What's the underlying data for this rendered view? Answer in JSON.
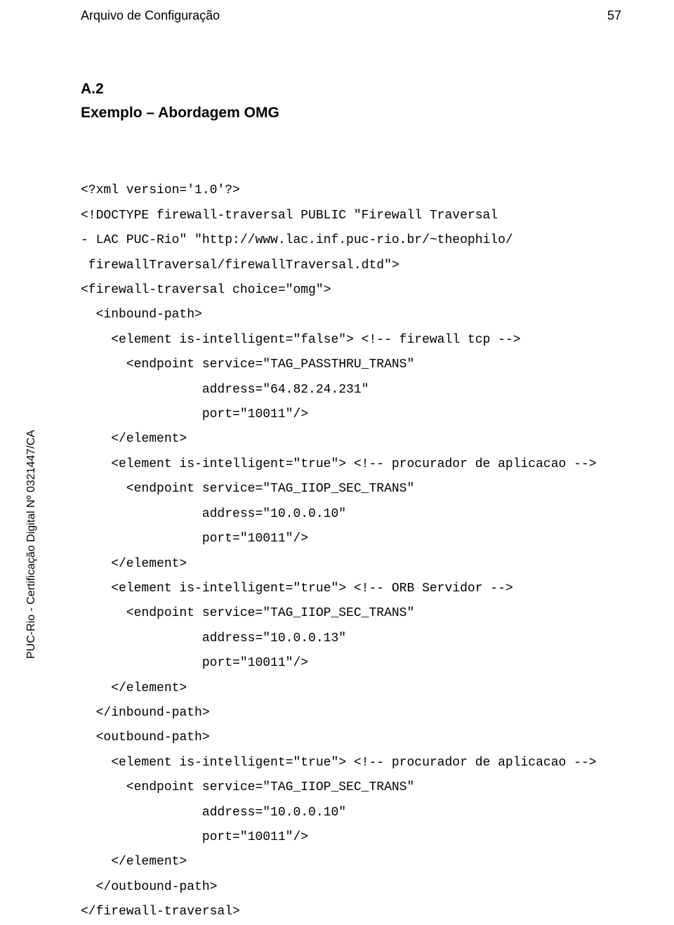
{
  "header": {
    "title": "Arquivo de Configuração",
    "page_number": "57"
  },
  "section": {
    "label": "A.2",
    "title": "Exemplo – Abordagem OMG"
  },
  "vertical_note": "PUC-Rio - Certificação Digital Nº 0321447/CA",
  "code": {
    "l01": "<?xml version='1.0'?>",
    "l02": "<!DOCTYPE firewall-traversal PUBLIC \"Firewall Traversal",
    "l03": "- LAC PUC-Rio\" \"http://www.lac.inf.puc-rio.br/~theophilo/",
    "l04": " firewallTraversal/firewallTraversal.dtd\">",
    "l05": "<firewall-traversal choice=\"omg\">",
    "l06": "  <inbound-path>",
    "l07": "    <element is-intelligent=\"false\"> <!-- firewall tcp -->",
    "l08": "      <endpoint service=\"TAG_PASSTHRU_TRANS\"",
    "l09": "                address=\"64.82.24.231\"",
    "l10": "                port=\"10011\"/>",
    "l11": "    </element>",
    "l12": "    <element is-intelligent=\"true\"> <!-- procurador de aplicacao -->",
    "l13": "      <endpoint service=\"TAG_IIOP_SEC_TRANS\"",
    "l14": "                address=\"10.0.0.10\"",
    "l15": "                port=\"10011\"/>",
    "l16": "    </element>",
    "l17": "    <element is-intelligent=\"true\"> <!-- ORB Servidor -->",
    "l18": "      <endpoint service=\"TAG_IIOP_SEC_TRANS\"",
    "l19": "                address=\"10.0.0.13\"",
    "l20": "                port=\"10011\"/>",
    "l21": "    </element>",
    "l22": "  </inbound-path>",
    "l23": "  <outbound-path>",
    "l24": "    <element is-intelligent=\"true\"> <!-- procurador de aplicacao -->",
    "l25": "      <endpoint service=\"TAG_IIOP_SEC_TRANS\"",
    "l26": "                address=\"10.0.0.10\"",
    "l27": "                port=\"10011\"/>",
    "l28": "    </element>",
    "l29": "  </outbound-path>",
    "l30": "</firewall-traversal>"
  }
}
